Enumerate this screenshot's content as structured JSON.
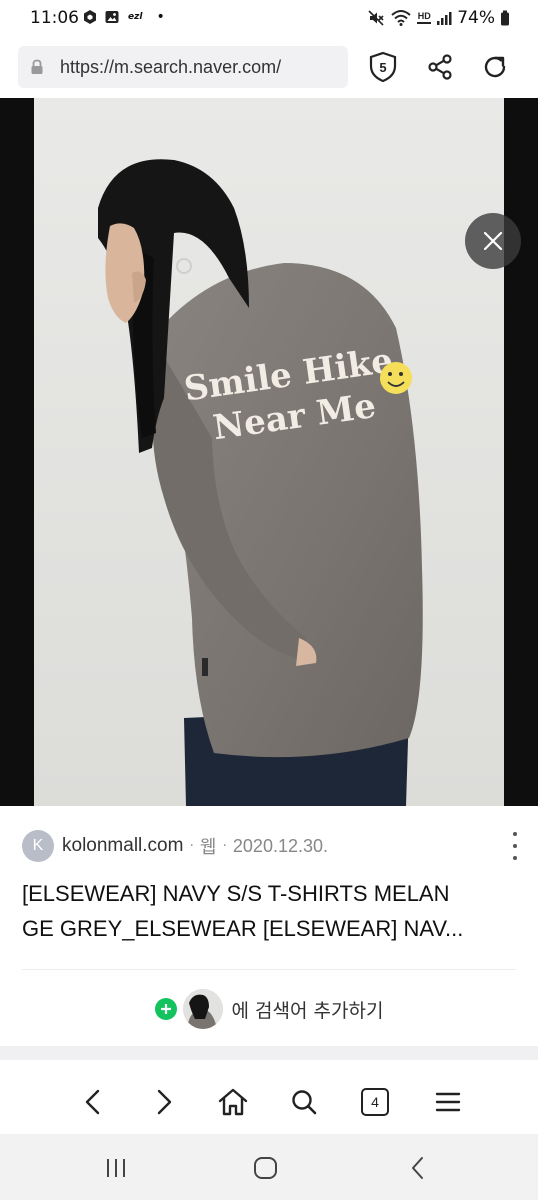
{
  "status_bar": {
    "time": "11:06",
    "left_icons": [
      "threema-icon",
      "gallery-icon"
    ],
    "ezl": "ezl",
    "dot": "•",
    "hd_label": "HD",
    "battery_percent": "74%"
  },
  "address_bar": {
    "url": "https://m.search.naver.com/",
    "shield_count": "5"
  },
  "viewer": {
    "print_lines": [
      "Smile Hike",
      "Near Me"
    ],
    "colors": {
      "background": "#0e0e0e",
      "shirt": "#7d7773",
      "jeans": "#1e2738"
    }
  },
  "result": {
    "source_initial": "K",
    "source_domain": "kolonmall.com",
    "sep1": "·",
    "source_type": "웹",
    "sep2": "·",
    "date": "2020.12.30.",
    "title_line1": "[ELSEWEAR] NAVY S/S T-SHIRTS MELAN",
    "title_line2": "GE GREY_ELSEWEAR [ELSEWEAR] NAV...",
    "add_text": "에 검색어 추가하기",
    "accent": "#12c35e"
  },
  "browser_nav": {
    "tab_count": "4"
  }
}
